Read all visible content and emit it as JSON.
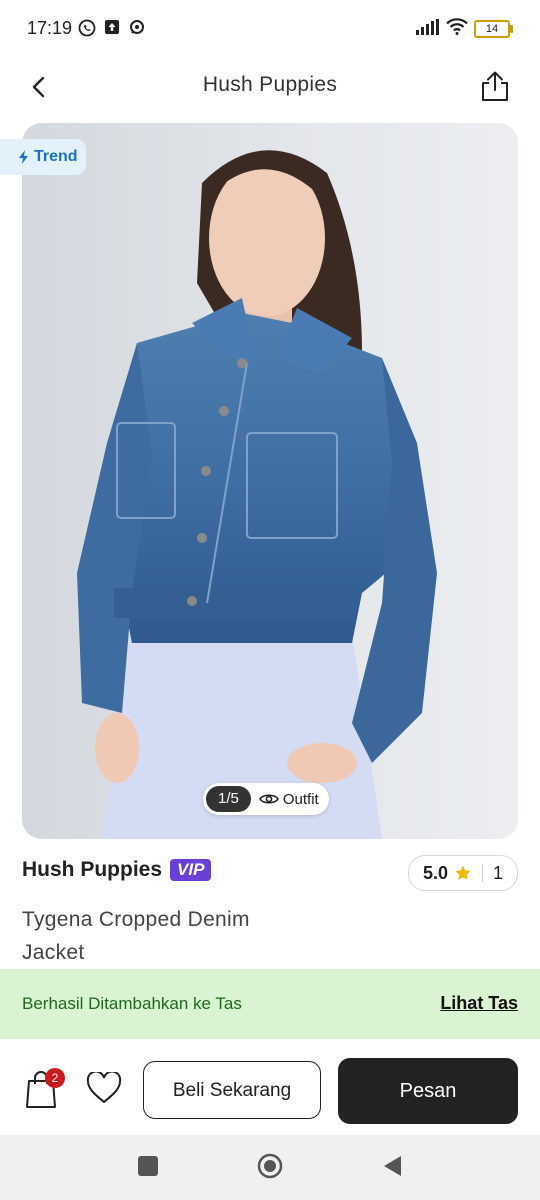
{
  "status_bar": {
    "time": "17:19",
    "battery": "14"
  },
  "header": {
    "title": "Hush Puppies"
  },
  "product_image": {
    "badge": "Trend",
    "counter": "1/5",
    "outfit_label": "Outfit"
  },
  "product": {
    "brand": "Hush Puppies",
    "vip_badge": "VIP",
    "rating": "5.0",
    "review_count": "1",
    "name": "Tygena Cropped Denim Jacket"
  },
  "toast": {
    "message": "Berhasil Ditambahkan ke Tas",
    "link": "Lihat Tas"
  },
  "bottom_bar": {
    "bag_count": "2",
    "buy_now_label": "Beli Sekarang",
    "order_label": "Pesan"
  },
  "colors": {
    "accent_vip": "#6a3fd8",
    "toast_bg": "#d9f3d3",
    "primary_dark": "#222222",
    "badge_red": "#d01a1a"
  }
}
